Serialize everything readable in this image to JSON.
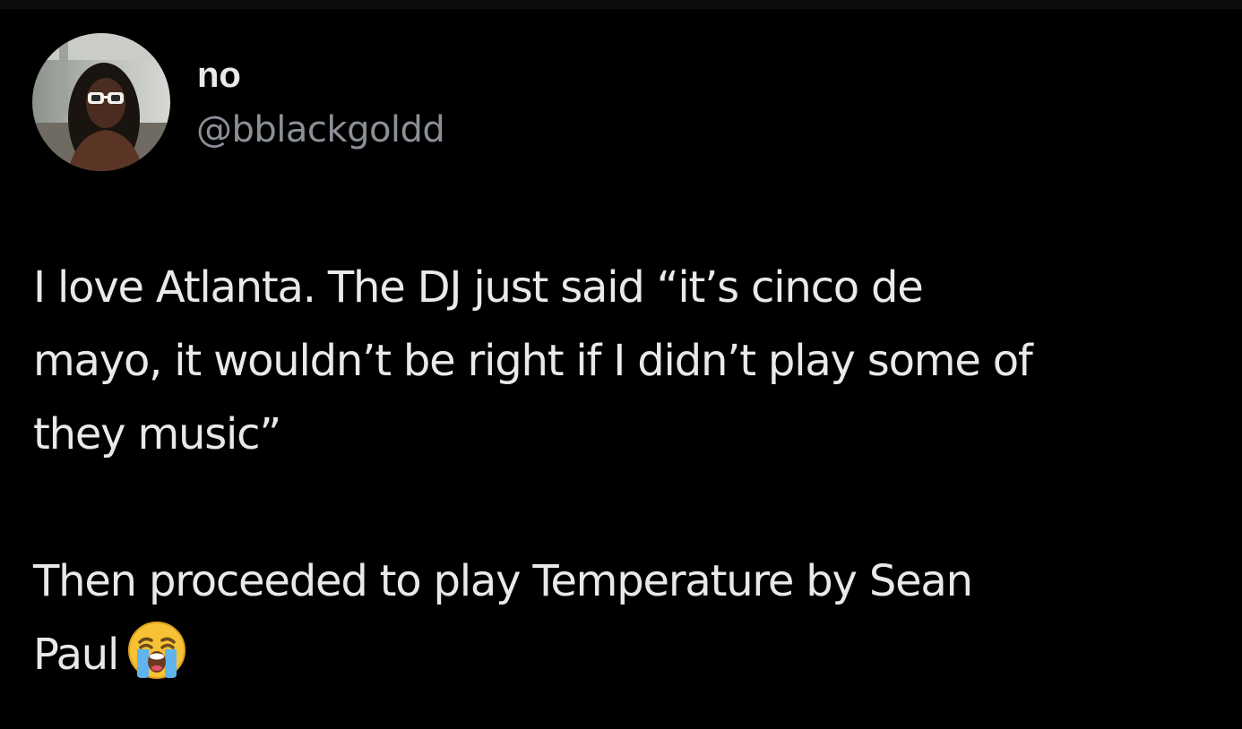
{
  "user": {
    "display_name": "no",
    "handle": "@bblackgoldd"
  },
  "tweet": {
    "paragraph1": {
      "line1": "I love Atlanta. The DJ just said “it’s cinco de",
      "line2": "mayo, it wouldn’t be right if I didn’t play some of",
      "line3": "they music”"
    },
    "paragraph2": {
      "line1": "Then proceeded to play Temperature by Sean",
      "line2": "Paul"
    },
    "emoji_name": "loudly-crying-face-icon"
  },
  "colors": {
    "background": "#000000",
    "primary_text": "#e7e9ea",
    "secondary_text": "#8b9096"
  }
}
